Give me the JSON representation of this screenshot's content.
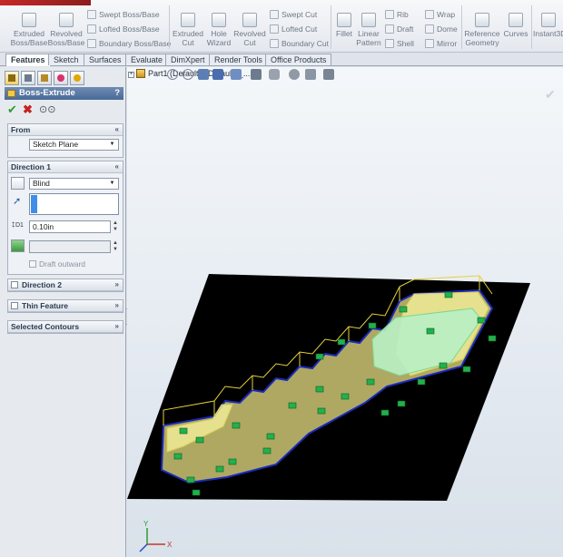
{
  "ribbon": {
    "big_buttons": [
      {
        "label": "Extruded\nBoss/Base"
      },
      {
        "label": "Revolved\nBoss/Base"
      },
      {
        "label": "Extruded\nCut"
      },
      {
        "label": "Hole\nWizard"
      },
      {
        "label": "Revolved\nCut"
      },
      {
        "label": "Fillet"
      },
      {
        "label": "Linear\nPattern"
      },
      {
        "label": "Reference\nGeometry"
      },
      {
        "label": "Curves"
      },
      {
        "label": "Instant3D"
      }
    ],
    "small_buttons": [
      {
        "label": "Swept Boss/Base"
      },
      {
        "label": "Lofted Boss/Base"
      },
      {
        "label": "Boundary Boss/Base"
      },
      {
        "label": "Swept Cut"
      },
      {
        "label": "Lofted Cut"
      },
      {
        "label": "Boundary Cut"
      },
      {
        "label": "Rib"
      },
      {
        "label": "Draft"
      },
      {
        "label": "Shell"
      },
      {
        "label": "Wrap"
      },
      {
        "label": "Dome"
      },
      {
        "label": "Mirror"
      }
    ]
  },
  "tabs": [
    "Features",
    "Sketch",
    "Surfaces",
    "Evaluate",
    "DimXpert",
    "Render Tools",
    "Office Products"
  ],
  "active_tab": "Features",
  "property_manager": {
    "title": "Boss-Extrude",
    "help": "?",
    "from": {
      "heading": "From",
      "value": "Sketch Plane"
    },
    "direction1": {
      "heading": "Direction 1",
      "end_condition": "Blind",
      "depth": "0.10in",
      "depth_label": "D1",
      "draft_outward": "Draft outward"
    },
    "direction2": {
      "heading": "Direction 2"
    },
    "thin_feature": {
      "heading": "Thin Feature"
    },
    "selected_contours": {
      "heading": "Selected Contours"
    }
  },
  "tree": {
    "expand": "+",
    "part_label": "Part1  (Default<<Default>_..."
  },
  "triad": {
    "x_label": "X",
    "y_label": "Y"
  },
  "colors": {
    "plane_fill": "#000000",
    "preview_fill": "#f4ef9a",
    "selected_fill": "#b8f0c4",
    "edge_blue": "#1a2bb8",
    "relation_green": "#22b14c"
  }
}
